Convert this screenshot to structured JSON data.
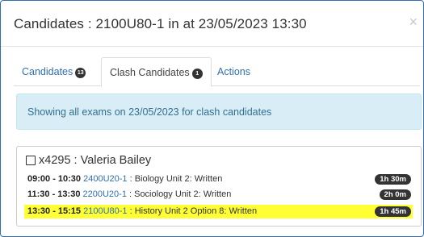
{
  "modal": {
    "title": "Candidates : 2100U80-1 in at 23/05/2023 13:30",
    "close_glyph": "×"
  },
  "tabs": [
    {
      "label": "Candidates",
      "badge": "13",
      "active": false
    },
    {
      "label": "Clash Candidates",
      "badge": "1",
      "active": true
    },
    {
      "label": "Actions",
      "badge": null,
      "active": false
    }
  ],
  "alert": {
    "text": "Showing all exams on 23/05/2023 for clash candidates"
  },
  "candidate": {
    "name": "x4295 : Valeria Bailey",
    "checked": false,
    "exams": [
      {
        "time": "09:00 - 10:30",
        "code": "2400U20-1",
        "title": " : Biology Unit 2: Written",
        "duration": "1h 30m",
        "clash": false
      },
      {
        "time": "11:30 - 13:30",
        "code": "2200U20-1",
        "title": " : Sociology Unit 2: Written",
        "duration": "2h 0m",
        "clash": false
      },
      {
        "time": "13:30 - 15:15",
        "code": "2100U80-1",
        "title": " : History Unit 2 Option 8: Written",
        "duration": "1h 45m",
        "clash": true
      }
    ]
  },
  "colors": {
    "link": "#2f6fb0",
    "alert_bg": "#d9edf7",
    "alert_text": "#31708f",
    "clash_highlight": "#ffff33",
    "badge_bg": "#333333"
  }
}
